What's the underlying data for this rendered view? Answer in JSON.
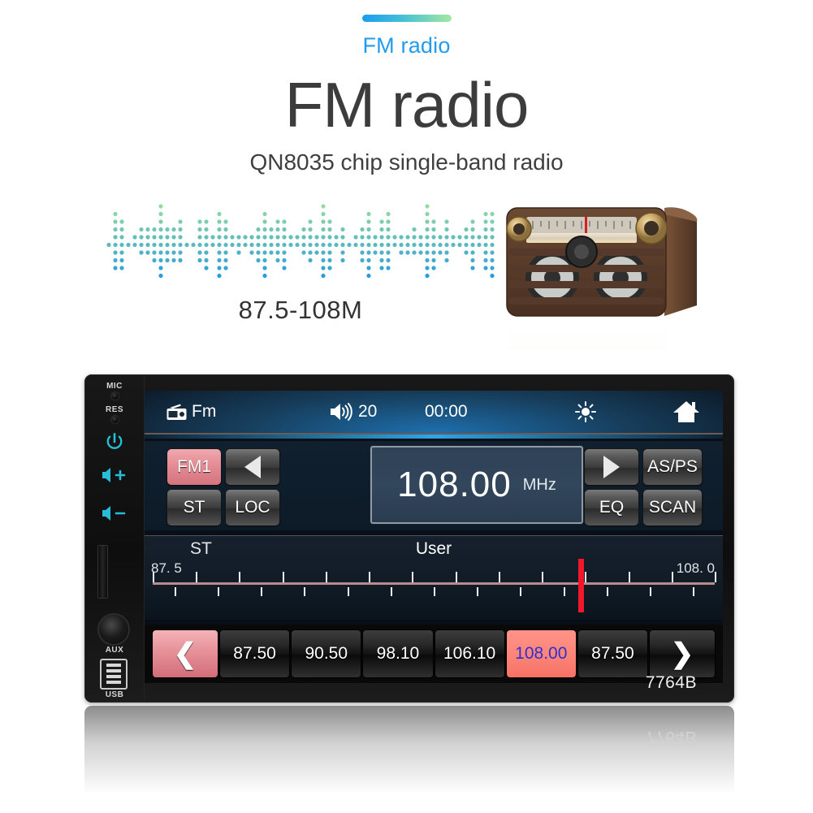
{
  "promo": {
    "eyebrow": "FM radio",
    "title": "FM radio",
    "subtitle": "QN8035 chip single-band radio",
    "freq_range": "87.5-108M",
    "accent_start": "#1b9df0",
    "accent_end": "#a5e8a0"
  },
  "device": {
    "model": "7764B",
    "model_reflection": "7764B",
    "side_panel": {
      "mic_label": "MIC",
      "res_label": "RES",
      "power_icon": "power-icon",
      "volume_up_label": "+",
      "volume_down_label": "−",
      "volume_icon": "speaker-icon",
      "sd_slot_icon": "sd-card-slot",
      "aux_label": "AUX",
      "usb_label": "USB"
    },
    "status_bar": {
      "source_icon": "radio-icon",
      "source_label": "Fm",
      "volume_icon": "speaker-icon",
      "volume_value": "20",
      "clock": "00:00",
      "brightness_icon": "brightness-icon",
      "home_icon": "home-icon"
    },
    "controls": {
      "band_label": "FM1",
      "prev_icon": "triangle-left-icon",
      "st_label": "ST",
      "loc_label": "LOC",
      "next_icon": "triangle-right-icon",
      "asps_label": "AS/PS",
      "eq_label": "EQ",
      "scan_label": "SCAN"
    },
    "frequency_display": {
      "value": "108.00",
      "unit": "MHz"
    },
    "tuner": {
      "stereo_label": "ST",
      "user_label": "User",
      "scale_min": "87. 5",
      "scale_max": "108. 0",
      "needle_position_percent": 74,
      "needle_color": "#f1182b",
      "major_ticks": 14,
      "minor_ticks": 13
    },
    "presets": {
      "prev_icon": "chevron-left-icon",
      "next_icon": "chevron-right-icon",
      "items": [
        {
          "label": "87.50",
          "active": false
        },
        {
          "label": "90.50",
          "active": false
        },
        {
          "label": "98.10",
          "active": false
        },
        {
          "label": "106.10",
          "active": false
        },
        {
          "label": "108.00",
          "active": true
        },
        {
          "label": "87.50",
          "active": false
        }
      ],
      "active_bg": "#fd8478",
      "active_text_color": "#2f2fd0"
    }
  }
}
